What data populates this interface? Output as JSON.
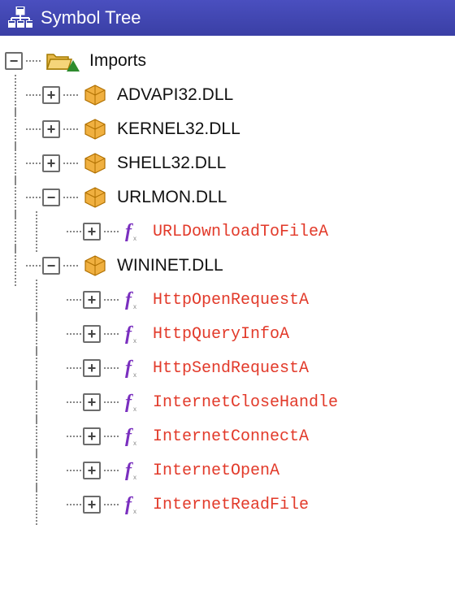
{
  "title": "Symbol Tree",
  "root": {
    "label": "Imports",
    "expanded": true,
    "children": [
      {
        "label": "ADVAPI32.DLL",
        "expanded": false,
        "type": "dll"
      },
      {
        "label": "KERNEL32.DLL",
        "expanded": false,
        "type": "dll"
      },
      {
        "label": "SHELL32.DLL",
        "expanded": false,
        "type": "dll"
      },
      {
        "label": "URLMON.DLL",
        "expanded": true,
        "type": "dll",
        "children": [
          {
            "label": "URLDownloadToFileA",
            "expanded": false,
            "type": "fn"
          }
        ]
      },
      {
        "label": "WININET.DLL",
        "expanded": true,
        "type": "dll",
        "children": [
          {
            "label": "HttpOpenRequestA",
            "expanded": false,
            "type": "fn"
          },
          {
            "label": "HttpQueryInfoA",
            "expanded": false,
            "type": "fn"
          },
          {
            "label": "HttpSendRequestA",
            "expanded": false,
            "type": "fn"
          },
          {
            "label": "InternetCloseHandle",
            "expanded": false,
            "type": "fn"
          },
          {
            "label": "InternetConnectA",
            "expanded": false,
            "type": "fn"
          },
          {
            "label": "InternetOpenA",
            "expanded": false,
            "type": "fn"
          },
          {
            "label": "InternetReadFile",
            "expanded": false,
            "type": "fn"
          }
        ]
      }
    ]
  }
}
